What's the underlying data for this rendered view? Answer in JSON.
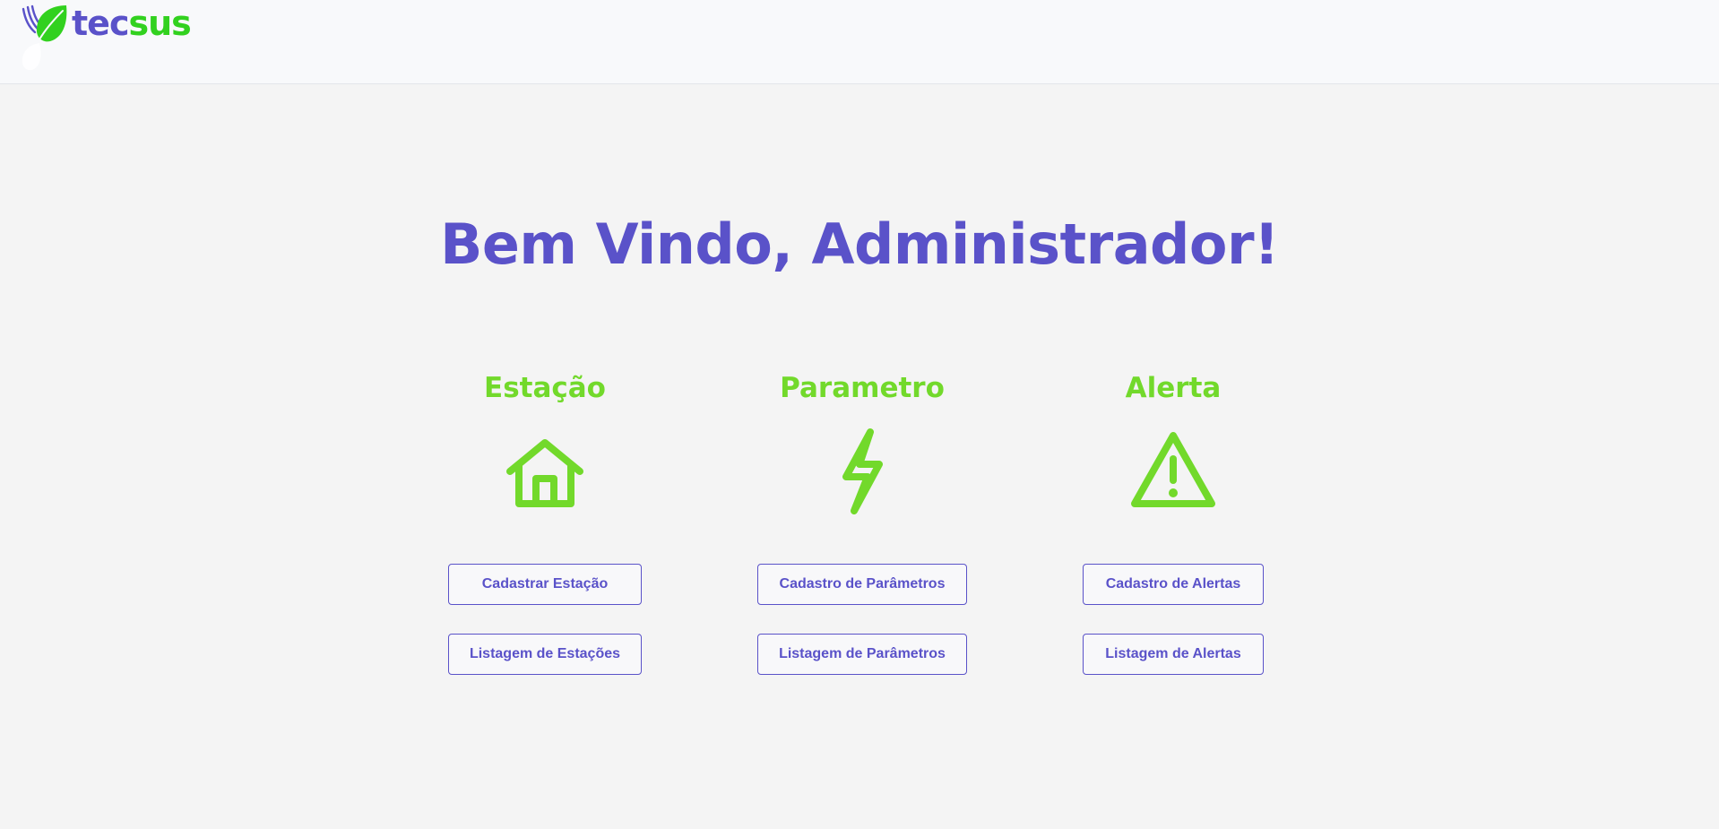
{
  "header": {
    "logo_tec": "tec",
    "logo_sus": "sus"
  },
  "welcome_title": "Bem Vindo, Administrador!",
  "sections": [
    {
      "title": "Estação",
      "icon": "house-icon",
      "primary_button": "Cadastrar Estação",
      "secondary_button": "Listagem de Estações"
    },
    {
      "title": "Parametro",
      "icon": "lightning-icon",
      "primary_button": "Cadastro de Parâmetros",
      "secondary_button": "Listagem de Parâmetros"
    },
    {
      "title": "Alerta",
      "icon": "warning-triangle-icon",
      "primary_button": "Cadastro de Alertas",
      "secondary_button": "Listagem de Alertas"
    }
  ],
  "colors": {
    "brand_purple": "#5a52c9",
    "brand_green": "#72d92b",
    "logo_green": "#32d11f",
    "page_background": "#f4f4f4",
    "header_background": "#f8f9fb"
  }
}
